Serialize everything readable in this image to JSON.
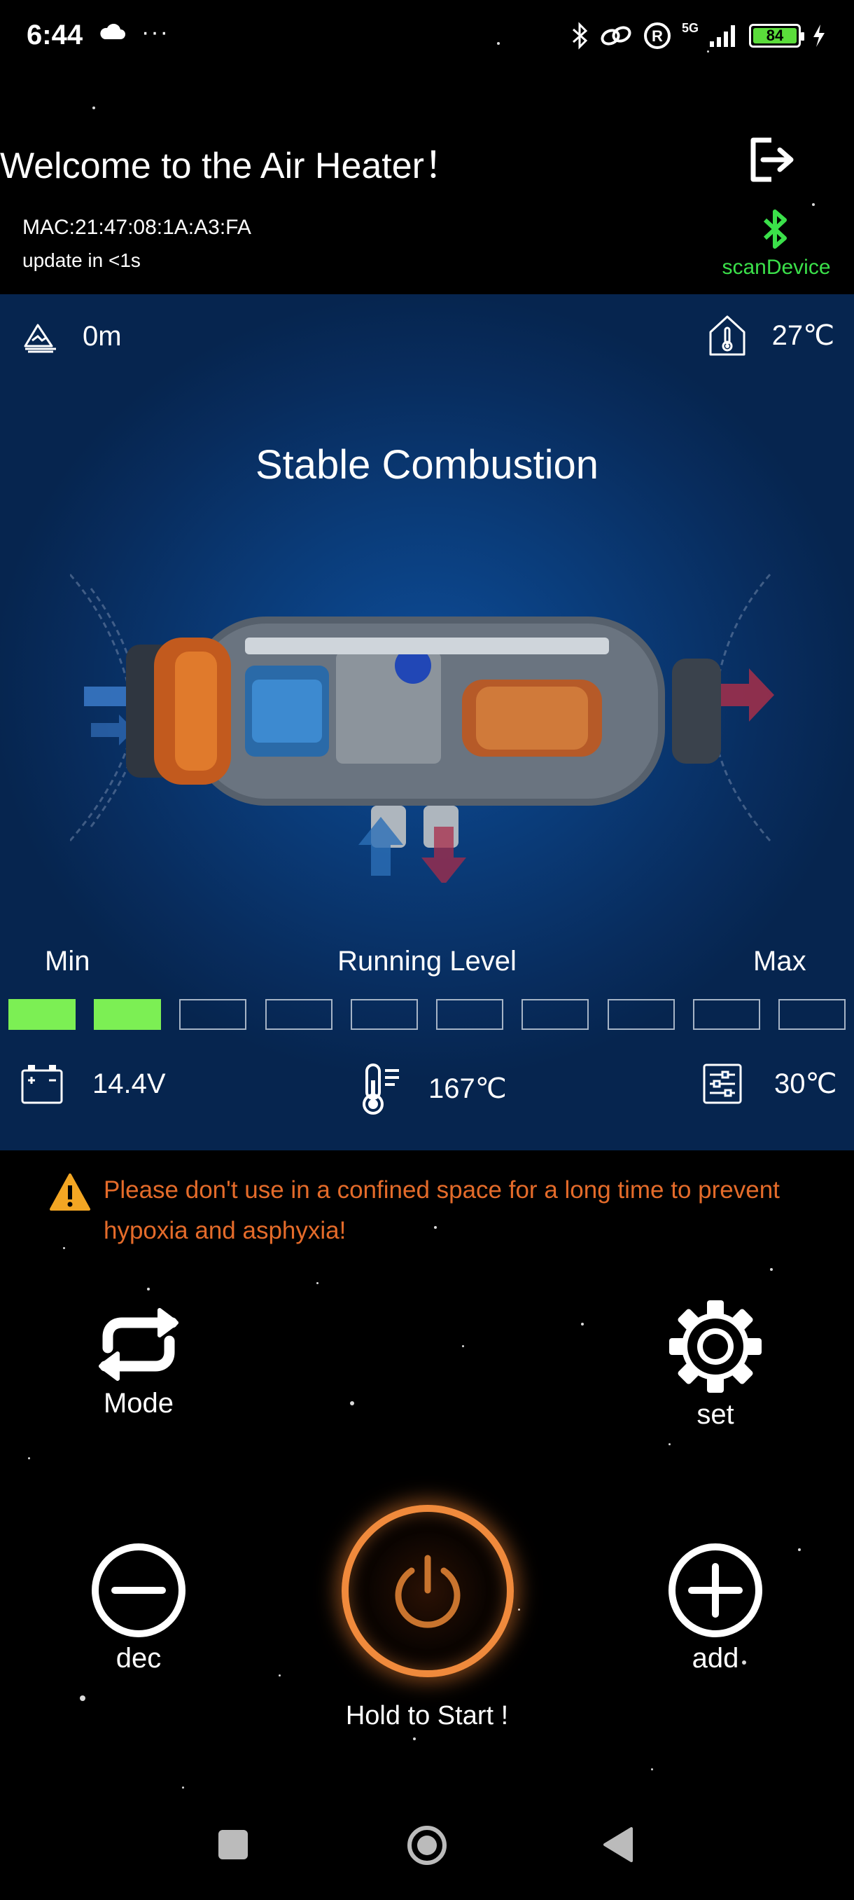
{
  "status_bar": {
    "time": "6:44",
    "more": "···",
    "network": "5G",
    "battery_level": "84"
  },
  "header": {
    "welcome": "Welcome to the Air Heater！",
    "mac": "MAC:21:47:08:1A:A3:FA",
    "update": "update in <1s",
    "scan_label": "scanDevice"
  },
  "panel": {
    "altitude": "0m",
    "ambient_temp": "27℃",
    "status": "Stable Combustion",
    "level": {
      "min_label": "Min",
      "title": "Running Level",
      "max_label": "Max",
      "total": 10,
      "active": 2,
      "active_color": "#7cef54"
    },
    "voltage": "14.4V",
    "heater_temp": "167℃",
    "set_temp": "30℃"
  },
  "warning": {
    "line1": "Please don't use in a confined space for a long time to prevent",
    "line2": "hypoxia and asphyxia!",
    "color": "#e46b2a"
  },
  "controls": {
    "mode_label": "Mode",
    "set_label": "set",
    "dec_label": "dec",
    "add_label": "add",
    "power_hint": "Hold to Start !",
    "power_color": "#f08a3c"
  },
  "icons": {
    "logout": "logout-icon",
    "bluetooth": "bluetooth-icon",
    "altitude": "mountain-icon",
    "ambient": "house-thermometer-icon",
    "battery": "car-battery-icon",
    "heater_temp": "thermometer-icon",
    "set_temp": "sliders-icon",
    "warning": "warning-triangle-icon",
    "mode": "repeat-icon",
    "set": "gear-icon",
    "dec": "minus-circle-icon",
    "add": "plus-circle-icon",
    "power": "power-icon"
  }
}
